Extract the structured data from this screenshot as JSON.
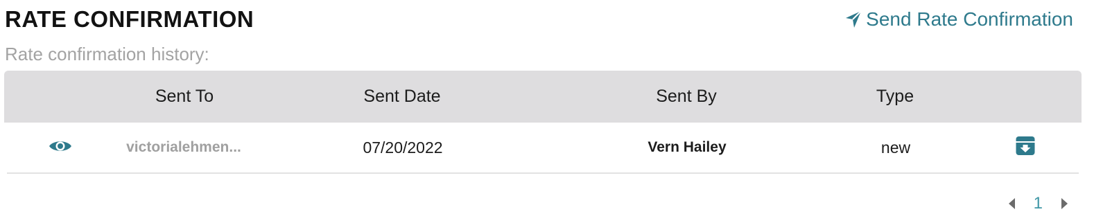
{
  "header": {
    "title": "RATE CONFIRMATION",
    "send_label": "Send Rate Confirmation",
    "send_icon": "paper-plane-icon"
  },
  "history_label": "Rate confirmation history:",
  "table": {
    "columns": [
      "",
      "Sent To",
      "Sent Date",
      "Sent By",
      "Type",
      ""
    ],
    "rows": [
      {
        "view_icon": "eye-icon",
        "sent_to": "victorialehmen...",
        "sent_date": "07/20/2022",
        "sent_by": "Vern Hailey",
        "type": "new",
        "archive_icon": "archive-download-icon"
      }
    ]
  },
  "pagination": {
    "prev_icon": "caret-left-icon",
    "current_page": "1",
    "next_icon": "caret-right-icon"
  },
  "colors": {
    "accent": "#2e7a8c",
    "header_bg": "#dedddf",
    "muted_text": "#a3a3a3"
  }
}
